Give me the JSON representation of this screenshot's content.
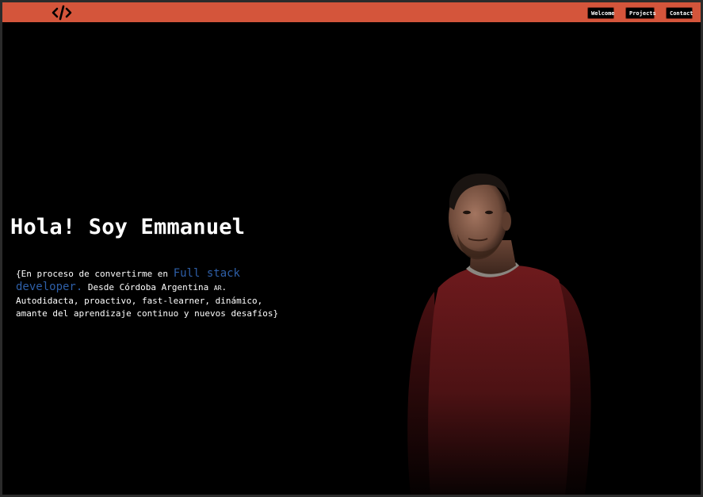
{
  "navbar": {
    "logo_icon": "code-brackets-icon",
    "background": "#d4553b",
    "links": [
      {
        "label": "Welcome"
      },
      {
        "label": "Projects"
      },
      {
        "label": "Contact"
      }
    ]
  },
  "hero": {
    "heading": "Hola! Soy Emmanuel",
    "bio_open": "{En proceso de convertirme en ",
    "bio_highlight": "Full stack developer.",
    "bio_location": " Desde Córdoba Argentina ",
    "bio_flag": "AR",
    "bio_rest": ". Autodidacta, proactivo, fast-learner, dinámico, amante del aprendizaje continuo y nuevos desafíos}",
    "highlight_color": "#2e5fa8"
  },
  "portrait": {
    "icon": "person-photo"
  }
}
